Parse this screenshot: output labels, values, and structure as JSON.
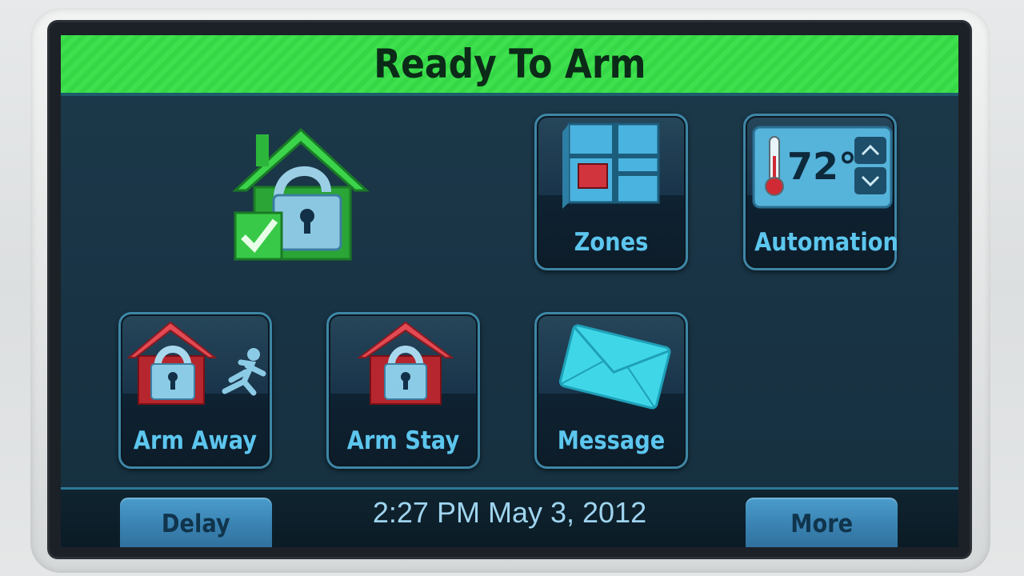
{
  "status": {
    "title": "Ready To Arm",
    "state_color": "#3ee04e"
  },
  "icons": {
    "status": "house-unlocked-check-icon",
    "zones": "zones-grid-icon",
    "automation": "thermostat-icon",
    "arm_away": "house-lock-running-person-icon",
    "arm_stay": "house-lock-icon",
    "message": "envelope-icon"
  },
  "tiles": {
    "zones": "Zones",
    "automation": "Automation",
    "arm_away": "Arm Away",
    "arm_stay": "Arm Stay",
    "message": "Message"
  },
  "automation": {
    "temperature": "72°"
  },
  "footer": {
    "delay": "Delay",
    "datetime": "2:27 PM May 3, 2012",
    "more": "More"
  }
}
